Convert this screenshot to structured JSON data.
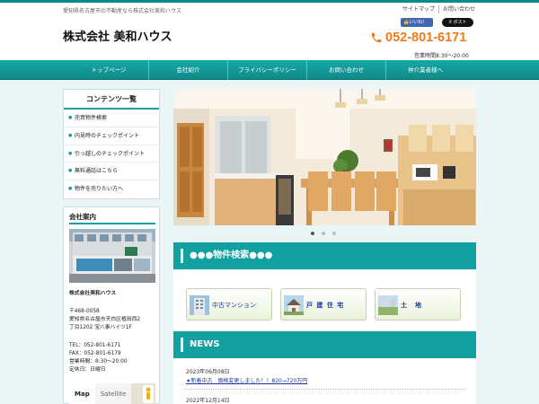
{
  "header": {
    "tagline": "愛知県名古屋市の不動産なら株式会社美和ハウス",
    "company_name": "株式会社 美和ハウス",
    "top_links": [
      "サイトマップ",
      "お問い合わせ"
    ],
    "fb_like": "いいね！",
    "x_post": "ポスト",
    "phone": "052-801-6171",
    "hours": "営業時間8:30～20:00"
  },
  "nav": {
    "items": [
      "トップページ",
      "会社紹介",
      "プライバシーポリシー",
      "お問い合わせ",
      "仲介業者様へ"
    ]
  },
  "sidebar": {
    "menu_title": "コンテンツ一覧",
    "menu_items": [
      "売買物件検索",
      "内見時のチェックポイント",
      "引っ越しのチェックポイント",
      "無料通話はこちら",
      "物件を売りたい方へ"
    ],
    "company_heading": "会社案内",
    "company_name": "株式会社美和ハウス",
    "postal": "〒468-0058",
    "address_1": "愛知県名古屋市天白区植田西2",
    "address_2": "丁目1202 宝八事ハイツ1F",
    "tel": "TEL：052-801-6171",
    "fax": "FAX：052-801-6179",
    "hours": "営業時間：8:30～20:00",
    "holiday": "定休日：日曜日",
    "map_tab": "Map",
    "satellite_tab": "Satellite"
  },
  "main": {
    "carousel_pages": 3,
    "carousel_active": 1,
    "property_search_title": "●●●物件検索●●●",
    "search_buttons": [
      "中古マンション",
      "戸 建 住 宅",
      "土　地"
    ],
    "news_title": "NEWS",
    "news": [
      {
        "date": "2023年06月08日",
        "text": "★新着中古　価格変更しました！！820→720万円"
      },
      {
        "date": "2022年12月14日",
        "text": ""
      }
    ]
  },
  "colors": {
    "teal": "#13a0a0",
    "phone_orange": "#ee7a1e",
    "link_blue": "#1a3aa0"
  }
}
